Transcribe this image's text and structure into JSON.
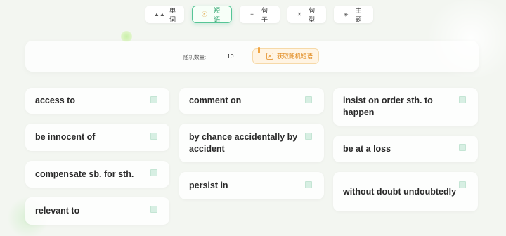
{
  "tabs": [
    {
      "label": "单词",
      "icon": "chart-icon"
    },
    {
      "label": "短语",
      "icon": "phrase-icon",
      "active": true
    },
    {
      "label": "句子",
      "icon": "lines-icon"
    },
    {
      "label": "句型",
      "icon": "cross-icon"
    },
    {
      "label": "主题",
      "icon": "layers-icon"
    }
  ],
  "controls": {
    "count_label": "随机数量:",
    "count_value": "10",
    "fetch_label": "获取随机短语"
  },
  "phrases": [
    "access to",
    "be innocent of",
    "compensate sb. for sth.",
    "relevant to",
    "comment on",
    "by chance accidentally by accident",
    "persist in",
    "insist on order sth. to happen",
    "be at a loss",
    "without doubt undoubtedly"
  ],
  "colors": {
    "accent": "#56c596",
    "fetch_accent": "#e08a1e",
    "background": "#f3f6f1"
  }
}
